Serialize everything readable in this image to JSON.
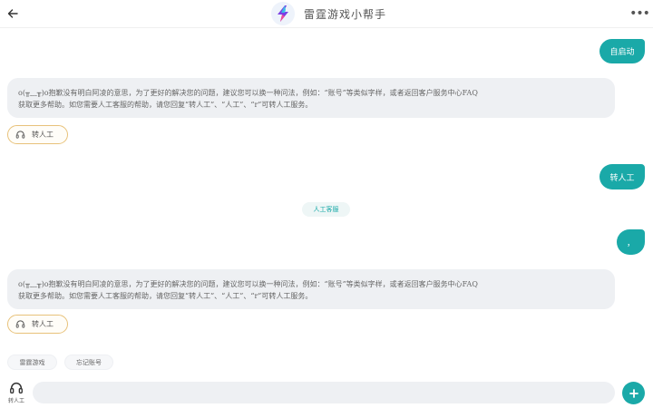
{
  "header": {
    "title": "雷霆游戏小帮手"
  },
  "messages": {
    "user_1": "自启动",
    "bot_1": {
      "line1": "o(╥﹏╥)o抱歉没有明白阿凌的意思，为了更好的解决您的问题，建议您可以换一种问法，例如：“账号”等类似字样，或者返回客户服务中心FAQ",
      "line2": "获取更多帮助。如您需要人工客服的帮助，请您回复“转人工”、“人工”、“r”可转人工服务。"
    },
    "transfer_label_1": "转人工",
    "user_2": "转人工",
    "system_tag": "人工客服",
    "user_3": "，",
    "bot_2": {
      "line1": "o(╥﹏╥)o抱歉没有明白阿凌的意思，为了更好的解决您的问题，建议您可以换一种问法，例如：“账号”等类似字样，或者返回客户服务中心FAQ",
      "line2": "获取更多帮助。如您需要人工客服的帮助，请您回复“转人工”、“人工”、“r”可转人工服务。"
    },
    "transfer_label_2": "转人工"
  },
  "quick_chips": [
    "雷霆游戏",
    "忘记账号"
  ],
  "bottom_bar": {
    "transfer_label": "转人工",
    "input_value": ""
  },
  "colors": {
    "accent": "#1aa9a8",
    "bubble_bot_bg": "#eef0f3",
    "transfer_border": "#e8c27a"
  },
  "icons": {
    "back": "arrow-left-icon",
    "logo": "lightning-logo-icon",
    "more": "more-dots-icon",
    "headset": "headset-icon",
    "plus": "plus-icon"
  }
}
